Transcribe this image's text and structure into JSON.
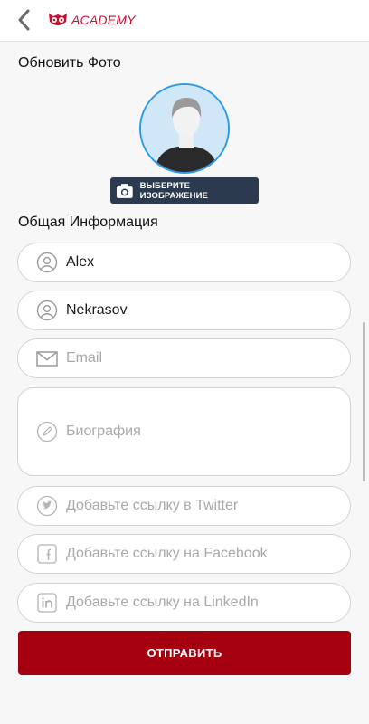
{
  "header": {
    "logo_text": "ACADEMY"
  },
  "photo_section": {
    "title": "Обновить Фото",
    "select_button_label": "ВЫБЕРИТЕ ИЗОБРАЖЕНИЕ"
  },
  "info_section": {
    "title": "Общая Информация",
    "first_name": {
      "value": "Alex"
    },
    "last_name": {
      "value": "Nekrasov"
    },
    "email": {
      "placeholder": "Email"
    },
    "bio": {
      "placeholder": "Биография"
    },
    "twitter": {
      "placeholder": "Добавьте ссылку в Twitter"
    },
    "facebook": {
      "placeholder": "Добавьте ссылку на Facebook"
    },
    "linkedin": {
      "placeholder": "Добавьте ссылку на LinkedIn"
    }
  },
  "submit_label": "ОТПРАВИТЬ",
  "colors": {
    "accent": "#a5000f",
    "brand": "#c8102e",
    "avatar_border": "#2f9be8",
    "select_button": "#2b3a4e"
  }
}
